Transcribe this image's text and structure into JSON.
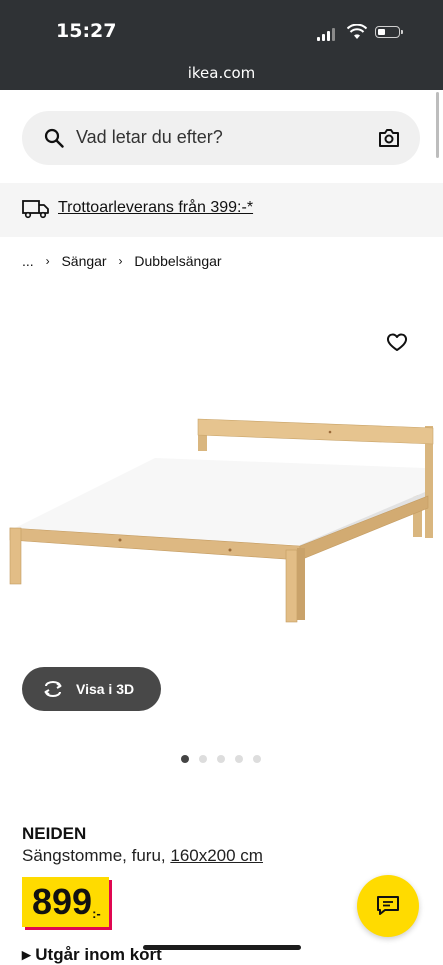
{
  "status_bar": {
    "time": "15:27",
    "url": "ikea.com"
  },
  "search": {
    "placeholder": "Vad letar du efter?"
  },
  "promo": {
    "text": "Trottoarleverans från 399:-*"
  },
  "breadcrumb": {
    "ellipsis": "...",
    "items": [
      "Sängar",
      "Dubbelsängar"
    ]
  },
  "gallery": {
    "view_3d_label": "Visa i 3D",
    "image_count": 5,
    "active_index": 0
  },
  "product": {
    "name": "NEIDEN",
    "description": "Sängstomme, furu,",
    "size_link": "160x200 cm",
    "price": "899",
    "currency": ":-",
    "status_partial": "Utgår inom kort"
  },
  "colors": {
    "price_yellow": "#ffdb00",
    "price_shadow": "#e00751",
    "status_bar": "#2f3235",
    "button_dark": "#484848"
  },
  "icons": [
    "search-icon",
    "camera-icon",
    "truck-icon",
    "chevron-right-icon",
    "heart-icon",
    "rotate-3d-icon",
    "chat-icon"
  ]
}
